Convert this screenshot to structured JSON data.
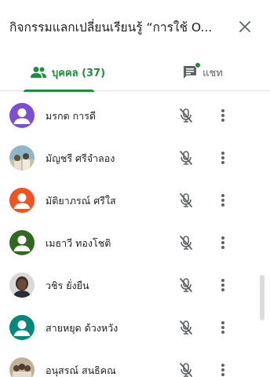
{
  "header": {
    "title": "กิจกรรมแลกเปลี่ยนเรียนรู้ “การใช้ O..."
  },
  "tabs": {
    "people": {
      "label": "บุคคล (37)",
      "icon": "people-icon"
    },
    "chat": {
      "label": "แชท",
      "icon": "chat-icon",
      "has_unread": true
    }
  },
  "colors": {
    "accent": "#1e8e3e",
    "avatar_purple": "#7b4fd3",
    "avatar_orange": "#f4511e",
    "avatar_green": "#33691e",
    "avatar_teal": "#00897b",
    "icon_grey": "#5f6368"
  },
  "participants": [
    {
      "name": "มรกต การดี",
      "avatar": "default-avatar",
      "avatar_color": "#7b4fd3",
      "mic": "muted"
    },
    {
      "name": "มัญชรี ศรีจำลอง",
      "avatar": "photo-avatar",
      "avatar_color": "#8fb6c9",
      "mic": "muted"
    },
    {
      "name": "มัติยาภรณ์ ศรีใส",
      "avatar": "default-avatar",
      "avatar_color": "#f4511e",
      "mic": "muted"
    },
    {
      "name": "เมธาวี ทองโชติ",
      "avatar": "default-avatar",
      "avatar_color": "#33691e",
      "mic": "muted"
    },
    {
      "name": "วชิร ยั่งยืน",
      "avatar": "photo-avatar",
      "avatar_color": "#3b2a22",
      "mic": "muted"
    },
    {
      "name": "สายหยุด ด้วงหวัง",
      "avatar": "default-avatar",
      "avatar_color": "#00897b",
      "mic": "muted"
    },
    {
      "name": "อนุสรณ์ สนธิคณ",
      "avatar": "photo-avatar",
      "avatar_color": "#a58e72",
      "mic": "muted"
    }
  ]
}
